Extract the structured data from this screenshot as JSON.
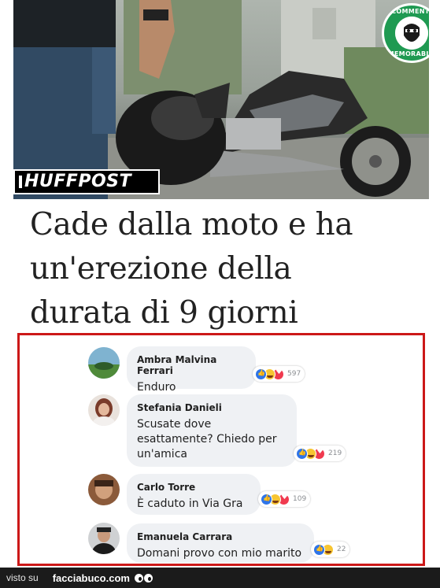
{
  "hero": {
    "brand": "HUFFPOST",
    "badge_top": "COMMENTI",
    "badge_bottom": "MEMORABILI",
    "badge_color": "#1f9a52"
  },
  "headline": {
    "line1": "Cade dalla moto e ha",
    "line2": "un'erezione della",
    "line3": "durata di 9 giorni"
  },
  "comments": [
    {
      "author": "Ambra Malvina Ferrari",
      "text": "Enduro",
      "reactions": [
        "like-icon",
        "haha-icon",
        "love-icon"
      ],
      "count": "597"
    },
    {
      "author": "Stefania Danieli",
      "text_lines": [
        "Scusate dove",
        "esattamente? Chiedo per",
        "un'amica"
      ],
      "reactions": [
        "like-icon",
        "haha-icon",
        "love-icon"
      ],
      "count": "219"
    },
    {
      "author": "Carlo Torre",
      "text": "È caduto in Via Gra",
      "reactions": [
        "like-icon",
        "haha-icon",
        "love-icon"
      ],
      "count": "109"
    },
    {
      "author": "Emanuela Carrara",
      "text": "Domani provo con mio marito",
      "reactions": [
        "like-icon",
        "haha-icon"
      ],
      "count": "22"
    }
  ],
  "footer": {
    "prefix": "visto su",
    "site": "facciabuco.com"
  },
  "colors": {
    "frame": "#cc1818",
    "bubble": "#eff1f4",
    "like": "#2f75e8",
    "haha": "#f7c531",
    "love": "#f03a4f"
  }
}
